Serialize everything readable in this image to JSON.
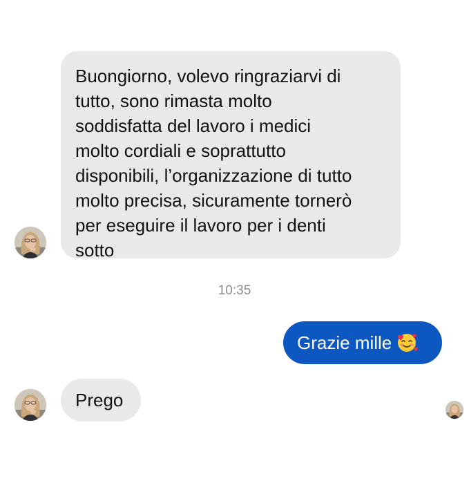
{
  "messages": {
    "incoming_1": {
      "text": "Buongiorno, volevo ringraziarvi di\ntutto, sono rimasta molto\nsoddisfatta del lavoro i medici\nmolto cordiali e soprattutto\ndisponibili, l’organizzazione di tutto\nmolto precisa, sicuramente tornerò\nper eseguire il lavoro per i denti\nsotto"
    },
    "timestamp": "10:35",
    "outgoing_1": {
      "text": "Grazie mille",
      "emoji": "smiling-face-with-hearts-icon"
    },
    "incoming_2": {
      "text": "Prego"
    }
  },
  "colors": {
    "incoming_bubble": "#e9e9eb",
    "outgoing_bubble": "#0d57c0",
    "timestamp_text": "#8a8d91"
  }
}
